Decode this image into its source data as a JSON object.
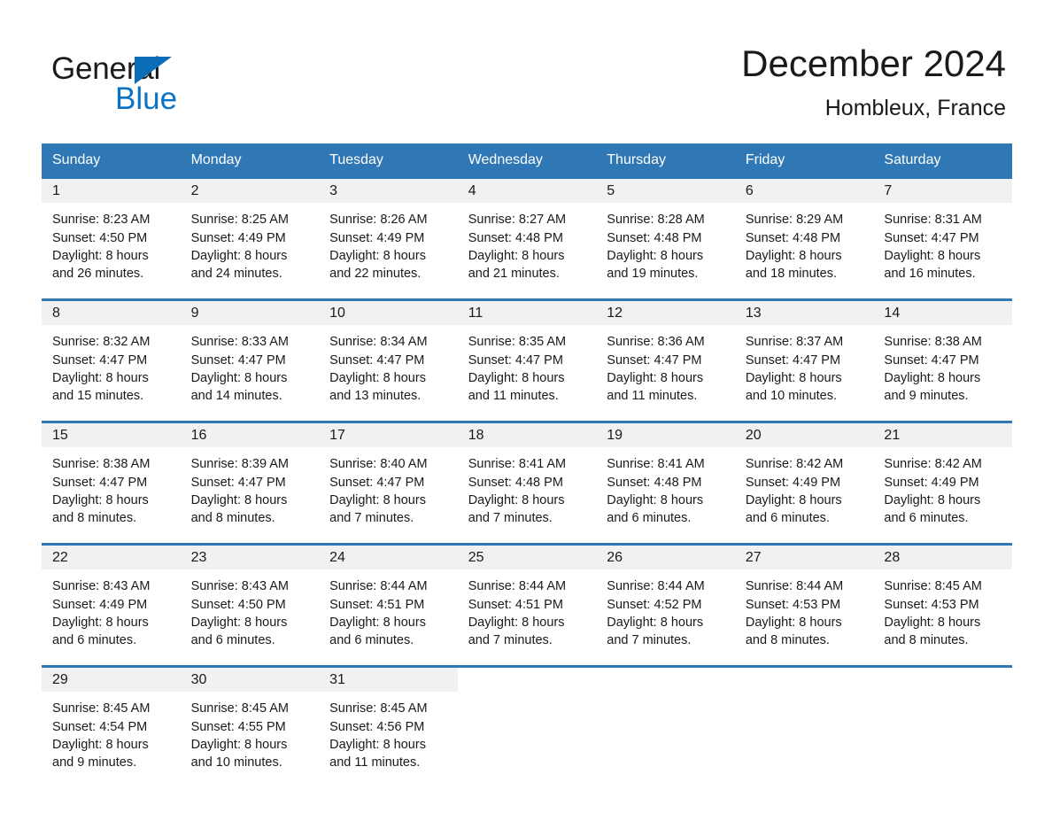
{
  "brand": {
    "name_part1": "General",
    "name_part2": "Blue",
    "triangle_color": "#0b6cb7",
    "blue_color": "#0b72c4"
  },
  "header": {
    "month_title": "December 2024",
    "location": "Hombleux, France"
  },
  "theme": {
    "header_bar_color": "#2f77b5",
    "day_band_color": "#f1f1f1",
    "text_color": "#1a1a1a"
  },
  "weekdays": [
    "Sunday",
    "Monday",
    "Tuesday",
    "Wednesday",
    "Thursday",
    "Friday",
    "Saturday"
  ],
  "weeks": [
    [
      {
        "day": "1",
        "sunrise": "Sunrise: 8:23 AM",
        "sunset": "Sunset: 4:50 PM",
        "daylight1": "Daylight: 8 hours",
        "daylight2": "and 26 minutes."
      },
      {
        "day": "2",
        "sunrise": "Sunrise: 8:25 AM",
        "sunset": "Sunset: 4:49 PM",
        "daylight1": "Daylight: 8 hours",
        "daylight2": "and 24 minutes."
      },
      {
        "day": "3",
        "sunrise": "Sunrise: 8:26 AM",
        "sunset": "Sunset: 4:49 PM",
        "daylight1": "Daylight: 8 hours",
        "daylight2": "and 22 minutes."
      },
      {
        "day": "4",
        "sunrise": "Sunrise: 8:27 AM",
        "sunset": "Sunset: 4:48 PM",
        "daylight1": "Daylight: 8 hours",
        "daylight2": "and 21 minutes."
      },
      {
        "day": "5",
        "sunrise": "Sunrise: 8:28 AM",
        "sunset": "Sunset: 4:48 PM",
        "daylight1": "Daylight: 8 hours",
        "daylight2": "and 19 minutes."
      },
      {
        "day": "6",
        "sunrise": "Sunrise: 8:29 AM",
        "sunset": "Sunset: 4:48 PM",
        "daylight1": "Daylight: 8 hours",
        "daylight2": "and 18 minutes."
      },
      {
        "day": "7",
        "sunrise": "Sunrise: 8:31 AM",
        "sunset": "Sunset: 4:47 PM",
        "daylight1": "Daylight: 8 hours",
        "daylight2": "and 16 minutes."
      }
    ],
    [
      {
        "day": "8",
        "sunrise": "Sunrise: 8:32 AM",
        "sunset": "Sunset: 4:47 PM",
        "daylight1": "Daylight: 8 hours",
        "daylight2": "and 15 minutes."
      },
      {
        "day": "9",
        "sunrise": "Sunrise: 8:33 AM",
        "sunset": "Sunset: 4:47 PM",
        "daylight1": "Daylight: 8 hours",
        "daylight2": "and 14 minutes."
      },
      {
        "day": "10",
        "sunrise": "Sunrise: 8:34 AM",
        "sunset": "Sunset: 4:47 PM",
        "daylight1": "Daylight: 8 hours",
        "daylight2": "and 13 minutes."
      },
      {
        "day": "11",
        "sunrise": "Sunrise: 8:35 AM",
        "sunset": "Sunset: 4:47 PM",
        "daylight1": "Daylight: 8 hours",
        "daylight2": "and 11 minutes."
      },
      {
        "day": "12",
        "sunrise": "Sunrise: 8:36 AM",
        "sunset": "Sunset: 4:47 PM",
        "daylight1": "Daylight: 8 hours",
        "daylight2": "and 11 minutes."
      },
      {
        "day": "13",
        "sunrise": "Sunrise: 8:37 AM",
        "sunset": "Sunset: 4:47 PM",
        "daylight1": "Daylight: 8 hours",
        "daylight2": "and 10 minutes."
      },
      {
        "day": "14",
        "sunrise": "Sunrise: 8:38 AM",
        "sunset": "Sunset: 4:47 PM",
        "daylight1": "Daylight: 8 hours",
        "daylight2": "and 9 minutes."
      }
    ],
    [
      {
        "day": "15",
        "sunrise": "Sunrise: 8:38 AM",
        "sunset": "Sunset: 4:47 PM",
        "daylight1": "Daylight: 8 hours",
        "daylight2": "and 8 minutes."
      },
      {
        "day": "16",
        "sunrise": "Sunrise: 8:39 AM",
        "sunset": "Sunset: 4:47 PM",
        "daylight1": "Daylight: 8 hours",
        "daylight2": "and 8 minutes."
      },
      {
        "day": "17",
        "sunrise": "Sunrise: 8:40 AM",
        "sunset": "Sunset: 4:47 PM",
        "daylight1": "Daylight: 8 hours",
        "daylight2": "and 7 minutes."
      },
      {
        "day": "18",
        "sunrise": "Sunrise: 8:41 AM",
        "sunset": "Sunset: 4:48 PM",
        "daylight1": "Daylight: 8 hours",
        "daylight2": "and 7 minutes."
      },
      {
        "day": "19",
        "sunrise": "Sunrise: 8:41 AM",
        "sunset": "Sunset: 4:48 PM",
        "daylight1": "Daylight: 8 hours",
        "daylight2": "and 6 minutes."
      },
      {
        "day": "20",
        "sunrise": "Sunrise: 8:42 AM",
        "sunset": "Sunset: 4:49 PM",
        "daylight1": "Daylight: 8 hours",
        "daylight2": "and 6 minutes."
      },
      {
        "day": "21",
        "sunrise": "Sunrise: 8:42 AM",
        "sunset": "Sunset: 4:49 PM",
        "daylight1": "Daylight: 8 hours",
        "daylight2": "and 6 minutes."
      }
    ],
    [
      {
        "day": "22",
        "sunrise": "Sunrise: 8:43 AM",
        "sunset": "Sunset: 4:49 PM",
        "daylight1": "Daylight: 8 hours",
        "daylight2": "and 6 minutes."
      },
      {
        "day": "23",
        "sunrise": "Sunrise: 8:43 AM",
        "sunset": "Sunset: 4:50 PM",
        "daylight1": "Daylight: 8 hours",
        "daylight2": "and 6 minutes."
      },
      {
        "day": "24",
        "sunrise": "Sunrise: 8:44 AM",
        "sunset": "Sunset: 4:51 PM",
        "daylight1": "Daylight: 8 hours",
        "daylight2": "and 6 minutes."
      },
      {
        "day": "25",
        "sunrise": "Sunrise: 8:44 AM",
        "sunset": "Sunset: 4:51 PM",
        "daylight1": "Daylight: 8 hours",
        "daylight2": "and 7 minutes."
      },
      {
        "day": "26",
        "sunrise": "Sunrise: 8:44 AM",
        "sunset": "Sunset: 4:52 PM",
        "daylight1": "Daylight: 8 hours",
        "daylight2": "and 7 minutes."
      },
      {
        "day": "27",
        "sunrise": "Sunrise: 8:44 AM",
        "sunset": "Sunset: 4:53 PM",
        "daylight1": "Daylight: 8 hours",
        "daylight2": "and 8 minutes."
      },
      {
        "day": "28",
        "sunrise": "Sunrise: 8:45 AM",
        "sunset": "Sunset: 4:53 PM",
        "daylight1": "Daylight: 8 hours",
        "daylight2": "and 8 minutes."
      }
    ],
    [
      {
        "day": "29",
        "sunrise": "Sunrise: 8:45 AM",
        "sunset": "Sunset: 4:54 PM",
        "daylight1": "Daylight: 8 hours",
        "daylight2": "and 9 minutes."
      },
      {
        "day": "30",
        "sunrise": "Sunrise: 8:45 AM",
        "sunset": "Sunset: 4:55 PM",
        "daylight1": "Daylight: 8 hours",
        "daylight2": "and 10 minutes."
      },
      {
        "day": "31",
        "sunrise": "Sunrise: 8:45 AM",
        "sunset": "Sunset: 4:56 PM",
        "daylight1": "Daylight: 8 hours",
        "daylight2": "and 11 minutes."
      },
      {
        "day": "",
        "sunrise": "",
        "sunset": "",
        "daylight1": "",
        "daylight2": ""
      },
      {
        "day": "",
        "sunrise": "",
        "sunset": "",
        "daylight1": "",
        "daylight2": ""
      },
      {
        "day": "",
        "sunrise": "",
        "sunset": "",
        "daylight1": "",
        "daylight2": ""
      },
      {
        "day": "",
        "sunrise": "",
        "sunset": "",
        "daylight1": "",
        "daylight2": ""
      }
    ]
  ]
}
